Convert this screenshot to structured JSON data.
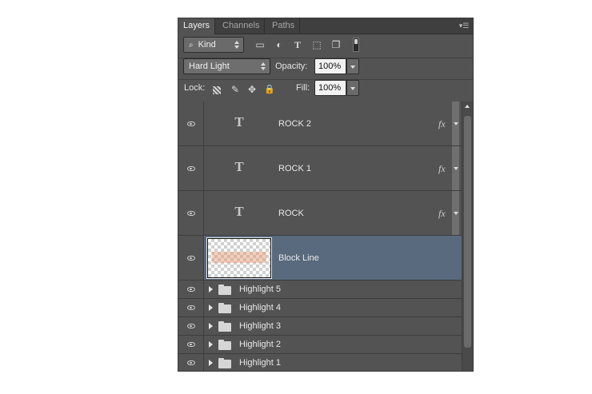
{
  "tabs": [
    "Layers",
    "Channels",
    "Paths"
  ],
  "filter": {
    "kind_label": "Kind",
    "filter_icons": [
      "image-filter-icon",
      "adjustment-filter-icon",
      "type-filter-icon",
      "shape-filter-icon",
      "smart-object-filter-icon",
      "filter-toggle-icon"
    ]
  },
  "blend": {
    "mode": "Hard Light",
    "opacity_label": "Opacity:",
    "opacity_value": "100%"
  },
  "lock": {
    "label": "Lock:",
    "fill_label": "Fill:",
    "fill_value": "100%",
    "lock_icons": [
      "lock-transparency-icon",
      "lock-image-icon",
      "lock-position-icon",
      "lock-all-icon"
    ]
  },
  "text_glyph": "T",
  "fx_label": "fx",
  "layers": [
    {
      "name": "ROCK 2",
      "type": "text",
      "fx": true
    },
    {
      "name": "ROCK 1",
      "type": "text",
      "fx": true
    },
    {
      "name": "ROCK",
      "type": "text",
      "fx": true
    },
    {
      "name": "Block Line",
      "type": "pixel",
      "selected": true
    },
    {
      "name": "Highlight 5",
      "type": "group"
    },
    {
      "name": "Highlight 4",
      "type": "group"
    },
    {
      "name": "Highlight 3",
      "type": "group"
    },
    {
      "name": "Highlight 2",
      "type": "group"
    },
    {
      "name": "Highlight 1",
      "type": "group"
    }
  ],
  "colors": {
    "panel_bg": "#535353",
    "selected_row": "#596a7e"
  }
}
